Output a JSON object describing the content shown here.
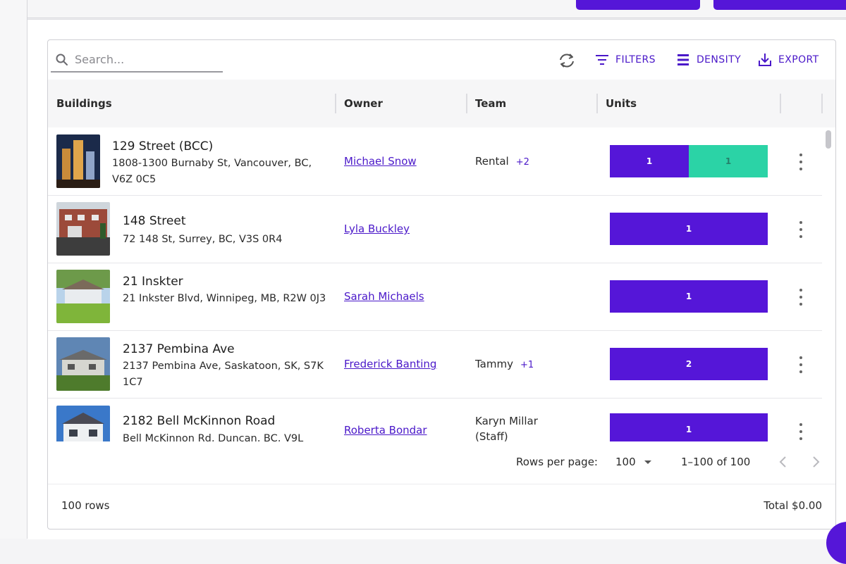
{
  "search": {
    "placeholder": "Search..."
  },
  "toolbar": {
    "filters_label": "FILTERS",
    "density_label": "DENSITY",
    "export_label": "EXPORT"
  },
  "columns": {
    "buildings": "Buildings",
    "owner": "Owner",
    "team": "Team",
    "units": "Units"
  },
  "rows": [
    {
      "name": "129 Street (BCC)",
      "address": "1808-1300 Burnaby St, Vancouver, BC, V6Z 0C5",
      "owner": "Michael Snow",
      "team": "Rental",
      "team_more": "+2",
      "units": [
        1,
        1
      ]
    },
    {
      "name": "148 Street",
      "address": "72 148 St, Surrey, BC, V3S 0R4",
      "owner": "Lyla Buckley",
      "team": "",
      "team_more": "",
      "units": [
        1
      ]
    },
    {
      "name": "21 Inskter",
      "address": "21 Inkster Blvd, Winnipeg, MB, R2W 0J3",
      "owner": "Sarah Michaels",
      "team": "",
      "team_more": "",
      "units": [
        1
      ]
    },
    {
      "name": "2137 Pembina Ave",
      "address": "2137 Pembina Ave, Saskatoon, SK, S7K 1C7",
      "owner": "Frederick Banting",
      "team": "Tammy",
      "team_more": "+1",
      "units": [
        2
      ]
    },
    {
      "name": "2182 Bell McKinnon Road",
      "address": "Bell McKinnon Rd, Duncan, BC, V9L",
      "owner": "Roberta Bondar",
      "team": "Karyn Millar (Staff)",
      "team_more": "",
      "units": [
        1
      ]
    }
  ],
  "pagination": {
    "rows_per_page_label": "Rows per page:",
    "rows_per_page": "100",
    "range": "1–100 of 100"
  },
  "footer": {
    "row_count": "100 rows",
    "total": "Total $0.00"
  },
  "colors": {
    "accent": "#5516d8",
    "link": "#4a18c9",
    "teal": "#2bd3a6"
  }
}
